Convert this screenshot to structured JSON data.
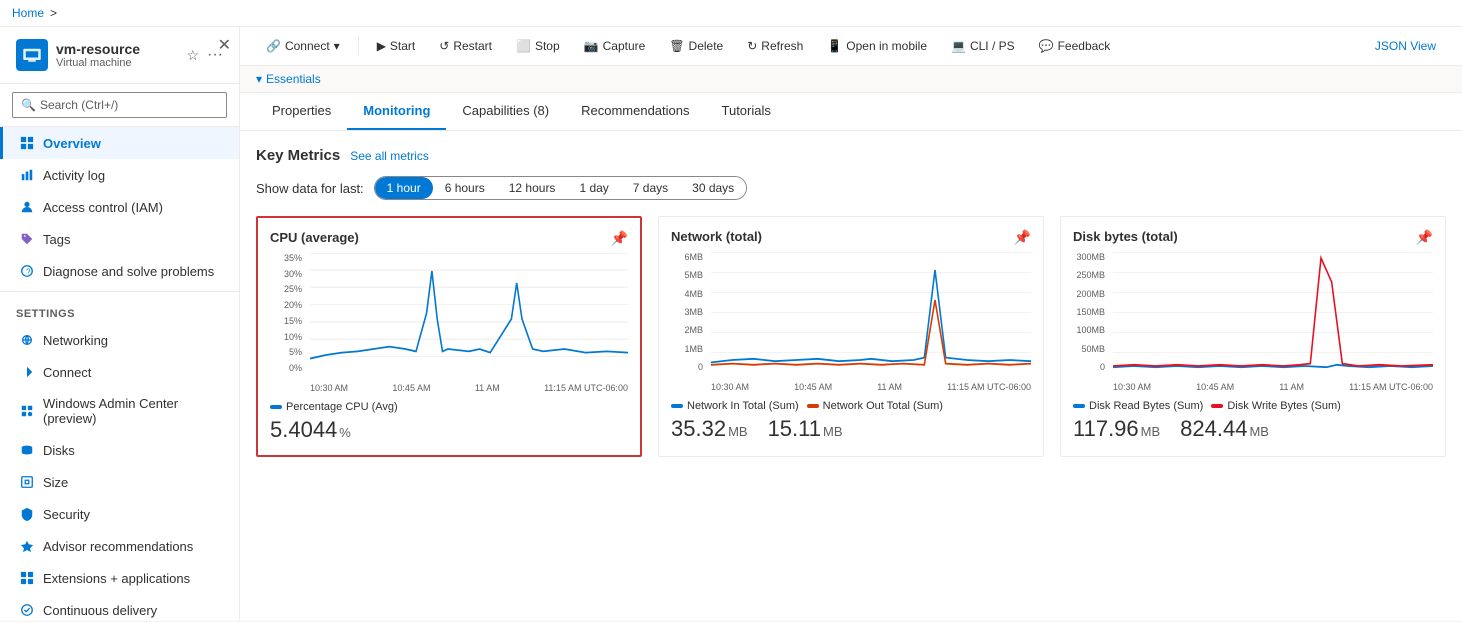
{
  "breadcrumb": {
    "home": "Home",
    "separator": ">"
  },
  "vm": {
    "name": "vm-resource",
    "subtitle": "Virtual machine"
  },
  "search": {
    "placeholder": "Search (Ctrl+/)"
  },
  "toolbar": {
    "connect": "Connect",
    "start": "Start",
    "restart": "Restart",
    "stop": "Stop",
    "capture": "Capture",
    "delete": "Delete",
    "refresh": "Refresh",
    "open_mobile": "Open in mobile",
    "cli_ps": "CLI / PS",
    "feedback": "Feedback",
    "json_view": "JSON View"
  },
  "essentials": {
    "label": "Essentials"
  },
  "tabs": [
    {
      "id": "properties",
      "label": "Properties"
    },
    {
      "id": "monitoring",
      "label": "Monitoring",
      "active": true
    },
    {
      "id": "capabilities",
      "label": "Capabilities (8)"
    },
    {
      "id": "recommendations",
      "label": "Recommendations"
    },
    {
      "id": "tutorials",
      "label": "Tutorials"
    }
  ],
  "monitoring": {
    "key_metrics_title": "Key Metrics",
    "see_metrics": "See all metrics",
    "time_filter_label": "Show data for last:",
    "time_options": [
      {
        "id": "1h",
        "label": "1 hour",
        "active": true
      },
      {
        "id": "6h",
        "label": "6 hours"
      },
      {
        "id": "12h",
        "label": "12 hours"
      },
      {
        "id": "1d",
        "label": "1 day"
      },
      {
        "id": "7d",
        "label": "7 days"
      },
      {
        "id": "30d",
        "label": "30 days"
      }
    ],
    "charts": [
      {
        "id": "cpu",
        "title": "CPU (average)",
        "highlighted": true,
        "y_labels": [
          "35%",
          "30%",
          "25%",
          "20%",
          "15%",
          "10%",
          "5%",
          "0%"
        ],
        "x_labels": [
          "10:30 AM",
          "10:45 AM",
          "11 AM",
          "11:15 AM UTC-06:00"
        ],
        "legend": [
          {
            "label": "Percentage CPU (Avg)",
            "color": "blue"
          }
        ],
        "metric_values": [
          {
            "value": "5.4044",
            "unit": "%"
          }
        ]
      },
      {
        "id": "network",
        "title": "Network (total)",
        "highlighted": false,
        "y_labels": [
          "6MB",
          "5MB",
          "4MB",
          "3MB",
          "2MB",
          "1MB",
          "0"
        ],
        "x_labels": [
          "10:30 AM",
          "10:45 AM",
          "11 AM",
          "11:15 AM UTC-06:00"
        ],
        "legend": [
          {
            "label": "Network In Total (Sum)",
            "color": "blue"
          },
          {
            "label": "Network Out Total (Sum)",
            "color": "orange"
          }
        ],
        "metric_values": [
          {
            "value": "35.32",
            "unit": "MB"
          },
          {
            "value": "15.11",
            "unit": "MB"
          }
        ]
      },
      {
        "id": "disk",
        "title": "Disk bytes (total)",
        "highlighted": false,
        "y_labels": [
          "300MB",
          "250MB",
          "200MB",
          "150MB",
          "100MB",
          "50MB",
          "0"
        ],
        "x_labels": [
          "10:30 AM",
          "10:45 AM",
          "11 AM",
          "11:15 AM UTC-06:00"
        ],
        "legend": [
          {
            "label": "Disk Read Bytes (Sum)",
            "color": "blue"
          },
          {
            "label": "Disk Write Bytes (Sum)",
            "color": "red"
          }
        ],
        "metric_values": [
          {
            "value": "117.96",
            "unit": "MB"
          },
          {
            "value": "824.44",
            "unit": "MB"
          }
        ]
      }
    ]
  },
  "sidebar": {
    "nav_items": [
      {
        "id": "overview",
        "label": "Overview",
        "active": true,
        "icon": "overview"
      },
      {
        "id": "activity-log",
        "label": "Activity log",
        "icon": "activity"
      },
      {
        "id": "access-control",
        "label": "Access control (IAM)",
        "icon": "iam"
      },
      {
        "id": "tags",
        "label": "Tags",
        "icon": "tags"
      },
      {
        "id": "diagnose",
        "label": "Diagnose and solve problems",
        "icon": "diagnose"
      }
    ],
    "settings_section": "Settings",
    "settings_items": [
      {
        "id": "networking",
        "label": "Networking",
        "icon": "networking"
      },
      {
        "id": "connect",
        "label": "Connect",
        "icon": "connect"
      },
      {
        "id": "windows-admin",
        "label": "Windows Admin Center (preview)",
        "icon": "admin"
      },
      {
        "id": "disks",
        "label": "Disks",
        "icon": "disks"
      },
      {
        "id": "size",
        "label": "Size",
        "icon": "size"
      },
      {
        "id": "security",
        "label": "Security",
        "icon": "security"
      },
      {
        "id": "advisor",
        "label": "Advisor recommendations",
        "icon": "advisor"
      },
      {
        "id": "extensions",
        "label": "Extensions + applications",
        "icon": "extensions"
      },
      {
        "id": "continuous",
        "label": "Continuous delivery",
        "icon": "delivery"
      }
    ]
  }
}
